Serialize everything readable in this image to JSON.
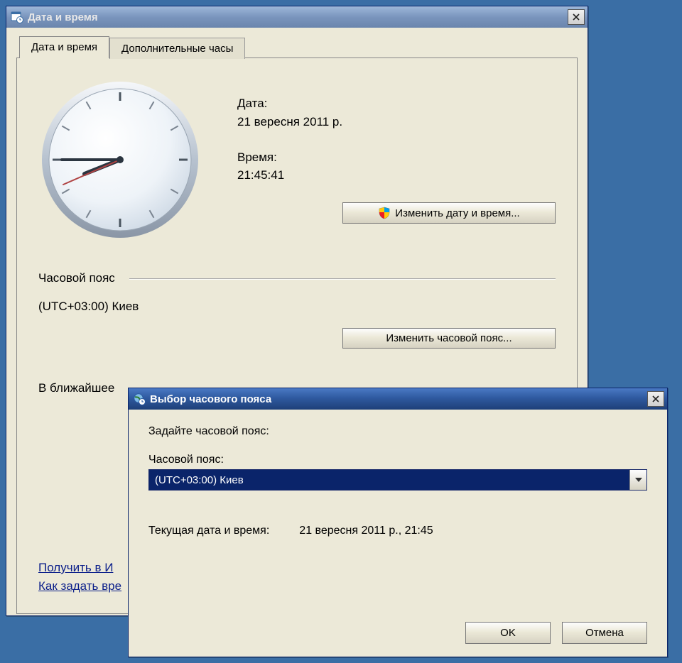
{
  "main_window": {
    "title": "Дата и время",
    "tabs": {
      "datetime": "Дата и время",
      "extra": "Дополнительные часы"
    },
    "date_label": "Дата:",
    "date_value": "21 вересня 2011 р.",
    "time_label": "Время:",
    "time_value": "21:45:41",
    "change_datetime_btn": "Изменить дату и время...",
    "tz_section_label": "Часовой пояс",
    "tz_current": "(UTC+03:00) Киев",
    "change_tz_btn": "Изменить часовой пояс...",
    "dst_text": "В ближайшее",
    "link_internet": "Получить в И",
    "link_howto": "Как задать вре"
  },
  "tz_dialog": {
    "title": "Выбор часового пояса",
    "instruction": "Задайте часовой пояс:",
    "combo_label": "Часовой пояс:",
    "selected": "(UTC+03:00) Киев",
    "current_label": "Текущая дата и время:",
    "current_value": "21 вересня 2011 р., 21:45",
    "ok": "OK",
    "cancel": "Отмена"
  },
  "clock": {
    "hour": 21,
    "minute": 45,
    "second": 41
  }
}
